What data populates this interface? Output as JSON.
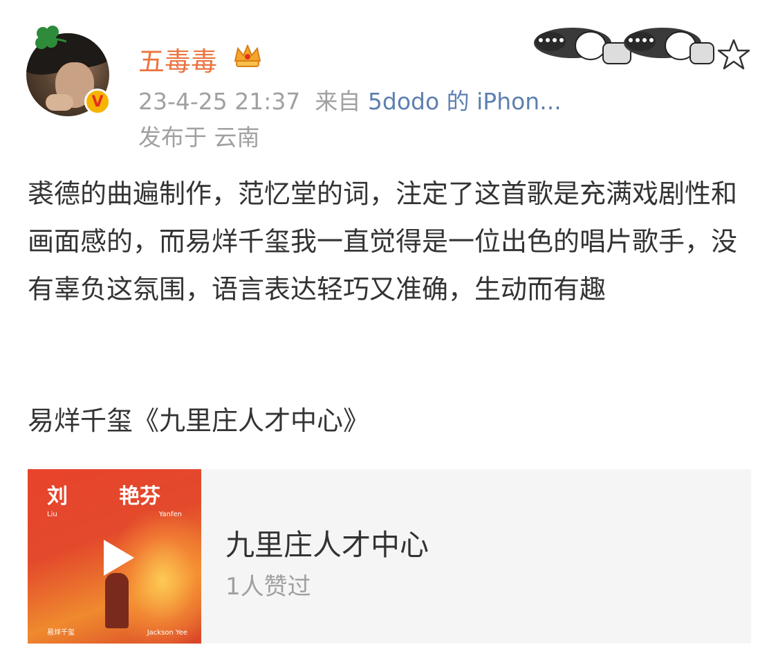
{
  "post": {
    "author": {
      "name": "五毒毒",
      "avatar_icon": "user-avatar",
      "verified_icon": "verified-v-icon",
      "verified_glyph": "V",
      "badge_icon": "crown-icon"
    },
    "meta": {
      "timestamp": "23-4-25 21:37",
      "source_prefix": "来自",
      "source": "5dodo 的 iPhon...",
      "location": "发布于 云南"
    },
    "decor": {
      "sticker_icon": "emoji-sticker",
      "favorite_icon": "star-icon"
    },
    "body": {
      "text": "裘德的曲遍制作，范忆堂的词，注定了这首歌是充满戏剧性和画面感的，而易烊千玺我一直觉得是一位出色的唱片歌手，没有辜负这氛围，语言表达轻巧又准确，生动而有趣",
      "song_line": "易烊千玺《九里庄人才中心》"
    },
    "music_card": {
      "cover": {
        "title_left": "刘",
        "title_right": "艳芬",
        "sub_left": "Liu",
        "sub_right": "Yanfen",
        "foot_left": "易烊千玺",
        "foot_right": "Jackson Yee"
      },
      "play_icon": "play-icon",
      "title": "九里庄人才中心",
      "likes": "1人赞过"
    }
  },
  "colors": {
    "username": "#eb7340",
    "meta": "#a0a0a0",
    "source_link": "#5d7fb1",
    "body_text": "#333333",
    "card_bg": "#f5f5f5",
    "verified_bg": "#f6b400"
  }
}
